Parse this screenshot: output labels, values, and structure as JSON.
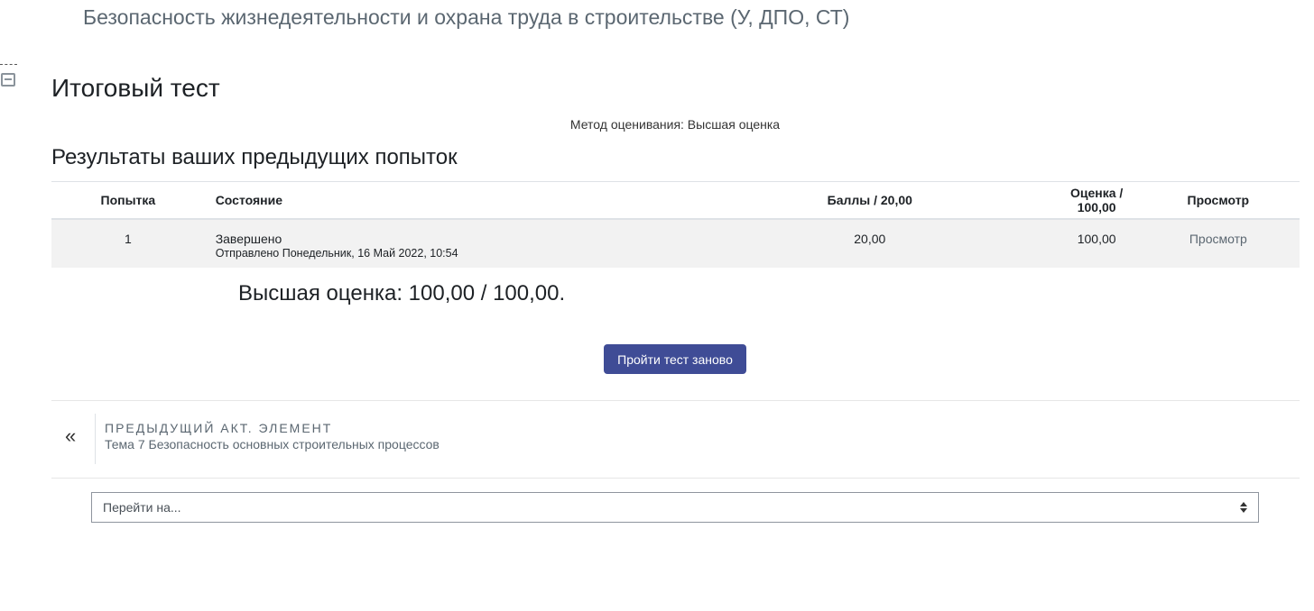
{
  "course": {
    "title": "Безопасность жизнедеятельности и охрана труда в строительстве (У, ДПО, СТ)"
  },
  "quiz": {
    "title": "Итоговый тест",
    "grading_method": "Метод оценивания: Высшая оценка",
    "results_heading": "Результаты ваших предыдущих попыток",
    "highest_grade": "Высшая оценка: 100,00 / 100,00.",
    "retake_label": "Пройти тест заново"
  },
  "attempts": {
    "columns": {
      "attempt": "Попытка",
      "state": "Состояние",
      "marks": "Баллы / 20,00",
      "grade": "Оценка / 100,00",
      "review": "Просмотр"
    },
    "rows": [
      {
        "attempt": "1",
        "state": "Завершено",
        "submitted": "Отправлено Понедельник, 16 Май 2022, 10:54",
        "marks": "20,00",
        "grade": "100,00",
        "review": "Просмотр"
      }
    ]
  },
  "navigation": {
    "prev_caption": "Предыдущий акт. элемент",
    "prev_title": "Тема 7 Безопасность основных строительных процессов",
    "prev_icon": "double-chevron-left-icon",
    "jump_placeholder": "Перейти на..."
  }
}
